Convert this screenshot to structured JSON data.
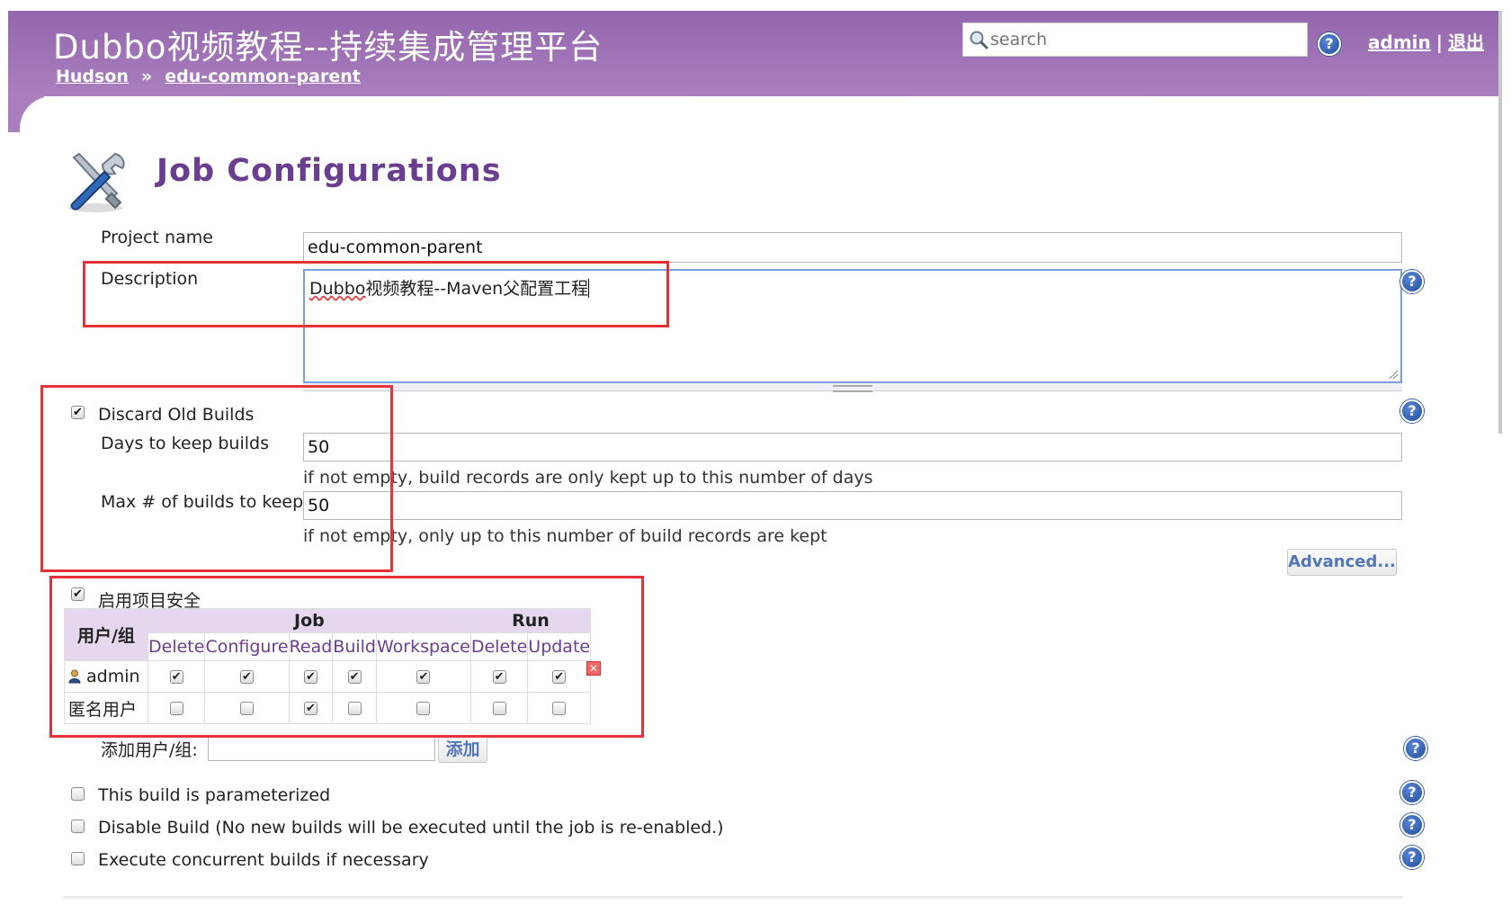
{
  "header": {
    "title": "Dubbo视频教程--持续集成管理平台",
    "breadcrumb": [
      "Hudson",
      "edu-common-parent"
    ],
    "breadcrumb_sep": "»",
    "search_placeholder": "search",
    "user": "admin",
    "logout": "退出",
    "user_sep": "|",
    "help_icon": "help-icon",
    "search_icon": "magnifier-icon"
  },
  "page": {
    "title": "Job Configurations",
    "icon": "tools-icon"
  },
  "form": {
    "project_name_label": "Project name",
    "project_name_value": "edu-common-parent",
    "description_label": "Description",
    "description_value_prefix": "Dubbo",
    "description_value_rest": "视频教程--Maven父配置工程",
    "discard_old_builds": {
      "label": "Discard Old Builds",
      "checked": true
    },
    "days_to_keep_label": "Days to keep builds",
    "days_to_keep_value": "50",
    "days_to_keep_hint": "if not empty, build records are only kept up to this number of days",
    "max_builds_label": "Max # of builds to keep",
    "max_builds_value": "50",
    "max_builds_hint": "if not empty, only up to this number of build records are kept",
    "advanced_button": "Advanced...",
    "project_security": {
      "label": "启用项目安全",
      "checked": true
    },
    "add_user_label": "添加用户/组:",
    "add_button": "添加",
    "parameterized": {
      "label": "This build is parameterized",
      "checked": false
    },
    "disable_build": {
      "label": "Disable Build (No new builds will be executed until the job is re-enabled.)",
      "checked": false
    },
    "concurrent": {
      "label": "Execute concurrent builds if necessary",
      "checked": false
    }
  },
  "matrix": {
    "user_header": "用户/组",
    "groups": [
      {
        "name": "Job",
        "span": 5
      },
      {
        "name": "Run",
        "span": 2
      }
    ],
    "columns": [
      "Delete",
      "Configure",
      "Read",
      "Build",
      "Workspace",
      "Delete",
      "Update"
    ],
    "rows": [
      {
        "name": "admin",
        "icon": "user-icon",
        "values": [
          true,
          true,
          true,
          true,
          true,
          true,
          true
        ],
        "removable": true
      },
      {
        "name": "匿名用户",
        "icon": "",
        "values": [
          false,
          false,
          true,
          false,
          false,
          false,
          false
        ],
        "removable": false
      }
    ]
  },
  "colors": {
    "header_purple": "#a97fbe",
    "title_purple": "#6a3d8f",
    "annotation_red": "#e8323a",
    "link_blue": "#5476b8"
  }
}
